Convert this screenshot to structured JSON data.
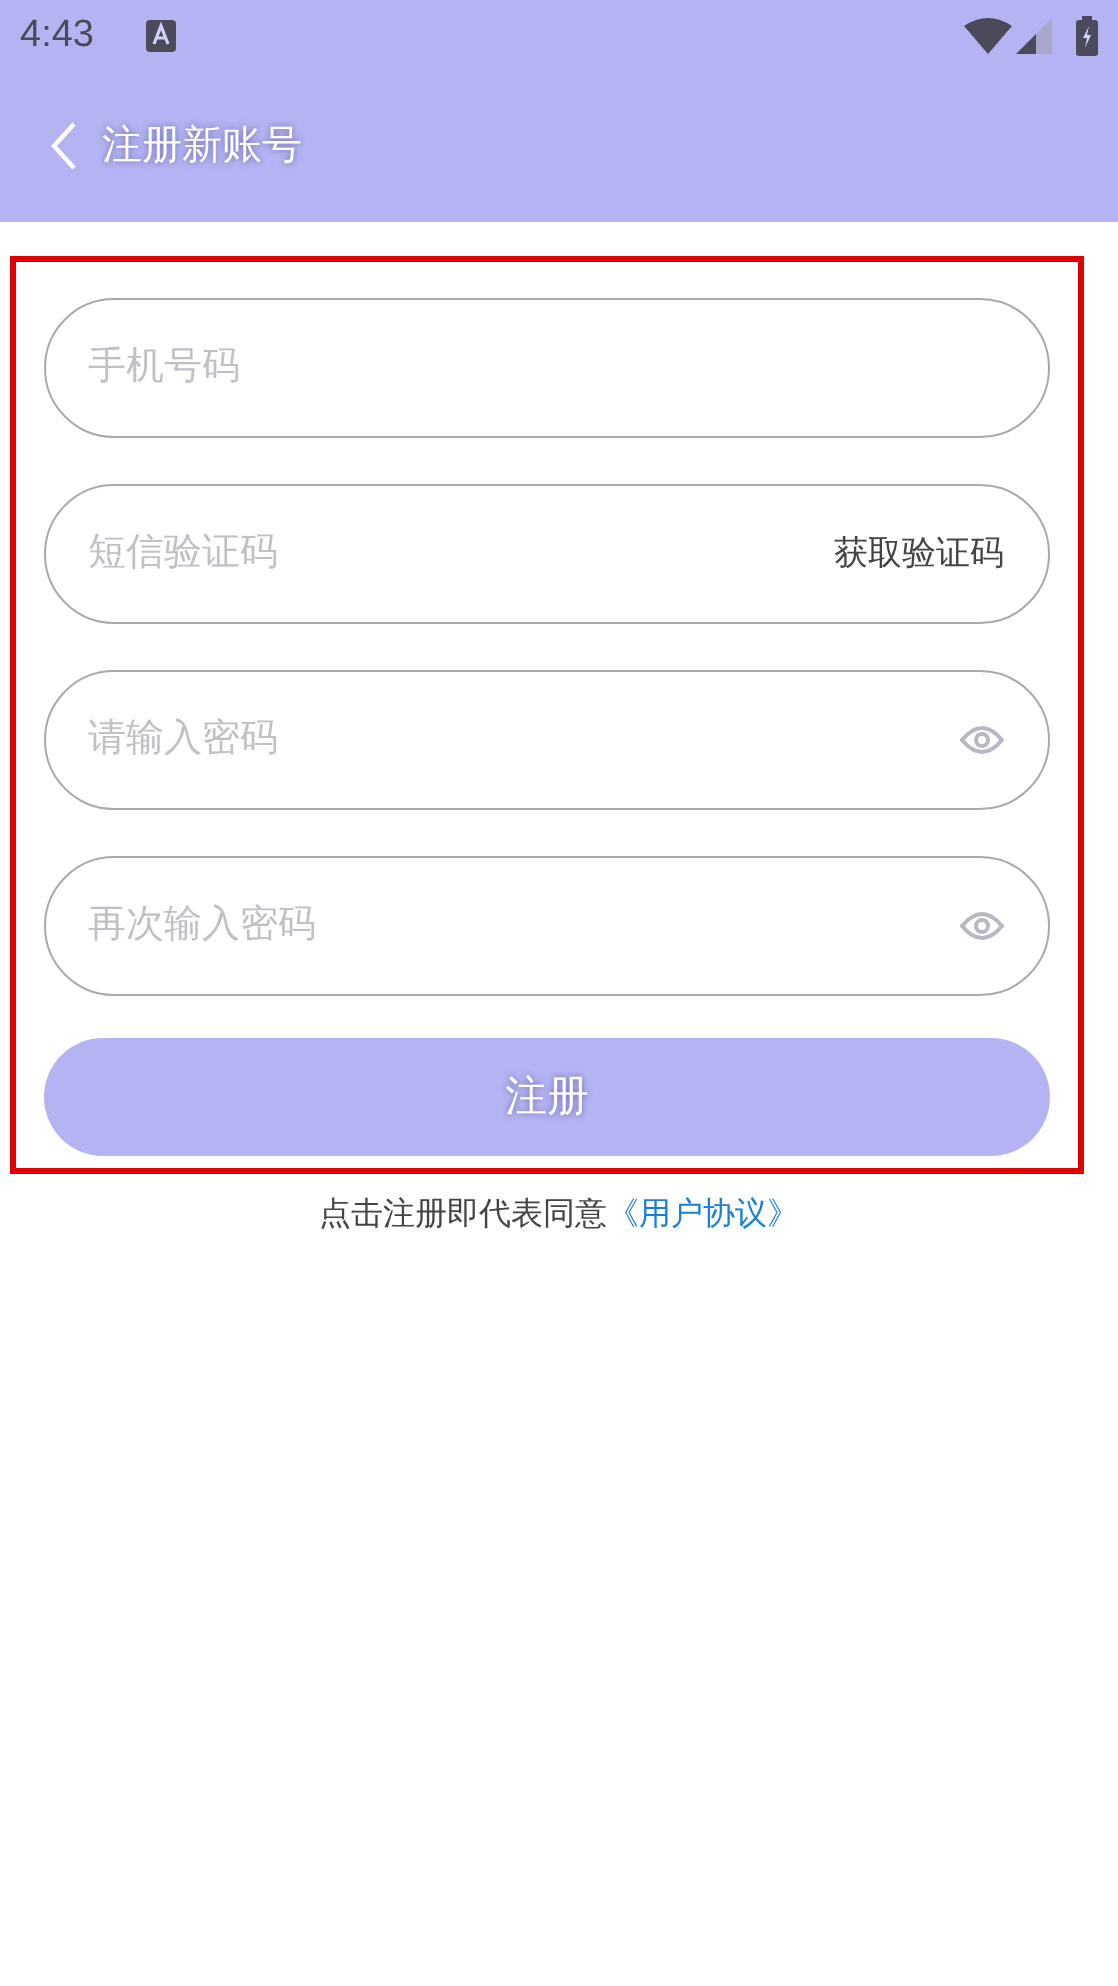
{
  "status_bar": {
    "time": "4:43"
  },
  "header": {
    "title": "注册新账号"
  },
  "fields": [
    {
      "kind": "plain",
      "placeholder": "手机号码"
    },
    {
      "kind": "code",
      "placeholder": "短信验证码",
      "action": "获取验证码"
    },
    {
      "kind": "password",
      "placeholder": "请输入密码"
    },
    {
      "kind": "password",
      "placeholder": "再次输入密码"
    }
  ],
  "submit": {
    "label": "注册",
    "disabled": true
  },
  "agreement": {
    "text": "点击注册即代表同意",
    "link": "《用户协议》"
  }
}
